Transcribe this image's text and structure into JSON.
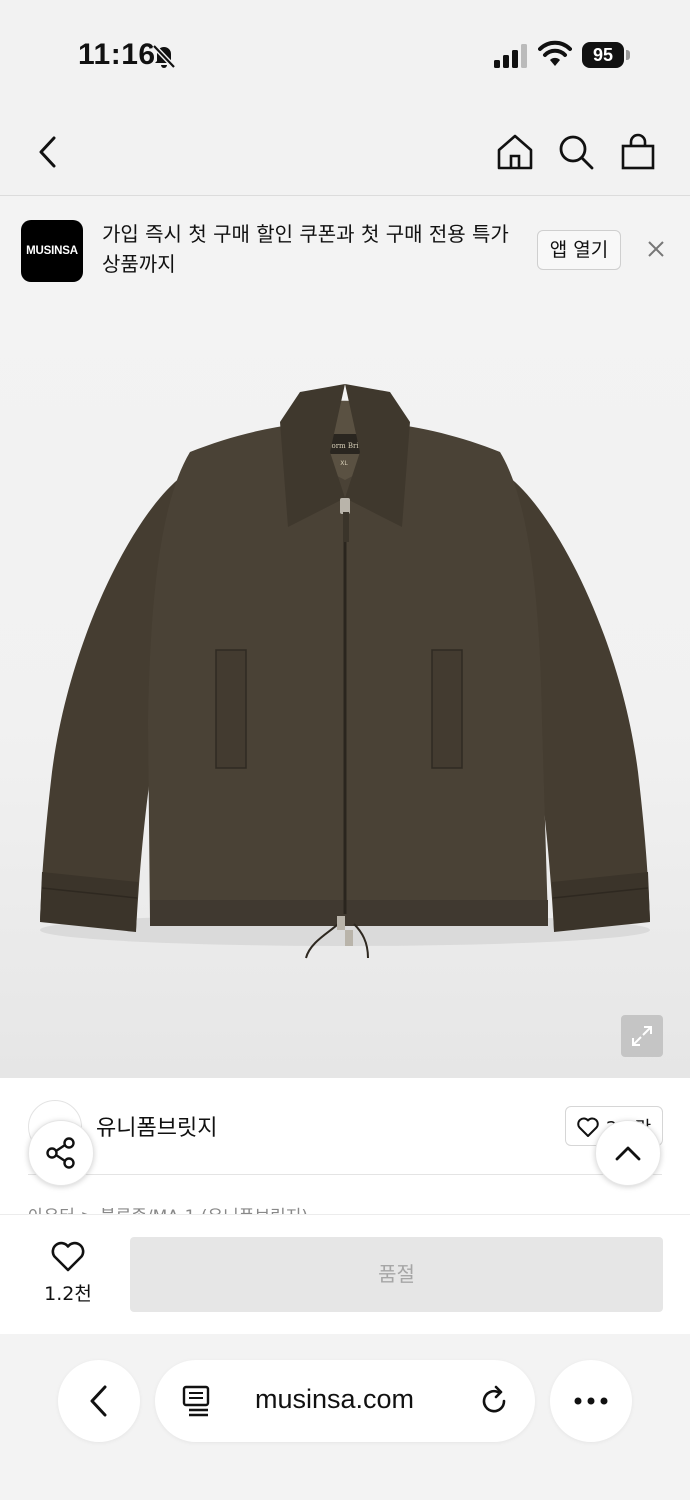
{
  "status_bar": {
    "time": "11:16",
    "battery": "95"
  },
  "promo": {
    "logo_text": "MUSINSA",
    "message": "가입 즉시 첫 구매 할인 쿠폰과 첫 구매 전용 특가 상품까지",
    "open_app_label": "앱 열기"
  },
  "product": {
    "brand_avatar_text": "",
    "brand_name": "유니폼브릿지",
    "brand_like_count": "2.1만",
    "breadcrumb": "아우터 > 블루종/MA-1 (유니폼브릿지)",
    "jacket_label_text": "Uniform Bridge",
    "jacket_size_text": "XL"
  },
  "bottom_bar": {
    "wish_count": "1.2천",
    "soldout_label": "품절"
  },
  "browser": {
    "url": "musinsa.com"
  },
  "colors": {
    "jacket": "#4a4236",
    "soldout_bg": "#e6e6e6",
    "soldout_text": "#a6a6a6"
  }
}
